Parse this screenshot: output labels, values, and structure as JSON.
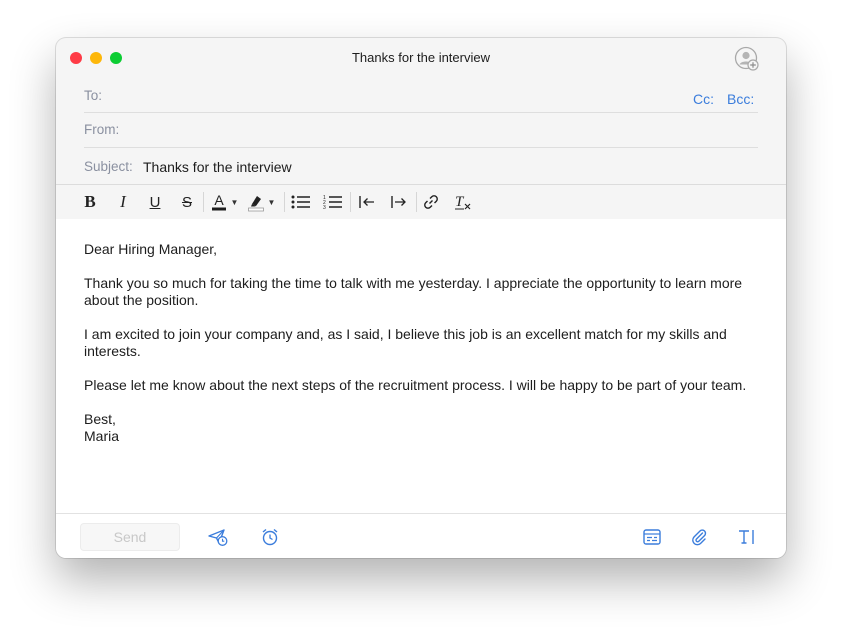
{
  "window": {
    "title": "Thanks for the interview"
  },
  "header": {
    "to_label": "To:",
    "to_value": "",
    "from_label": "From:",
    "from_value": "",
    "subject_label": "Subject:",
    "subject_value": "Thanks for the interview",
    "cc_label": "Cc:",
    "bcc_label": "Bcc:"
  },
  "toolbar": {
    "bold": "B",
    "italic": "I",
    "underline": "U",
    "strikethrough": "S",
    "text_color": "A",
    "text_color_swatch": "#1d1d1d",
    "highlight_swatch": "#ffffff"
  },
  "message": {
    "greeting": "Dear Hiring Manager,",
    "paragraphs": [
      "Thank you so much for taking the time to talk with me yesterday. I appreciate the opportunity to learn more about the position.",
      "I am excited to join your company and, as I said, I believe this job is an excellent match for my skills and interests.",
      "Please let me know about the next steps of the recruitment process. I will be happy to be part of your team."
    ],
    "closing": "Best,",
    "signature": "Maria"
  },
  "footer": {
    "send_label": "Send"
  },
  "colors": {
    "accent": "#3b7ddc",
    "label": "#8a90a0"
  }
}
